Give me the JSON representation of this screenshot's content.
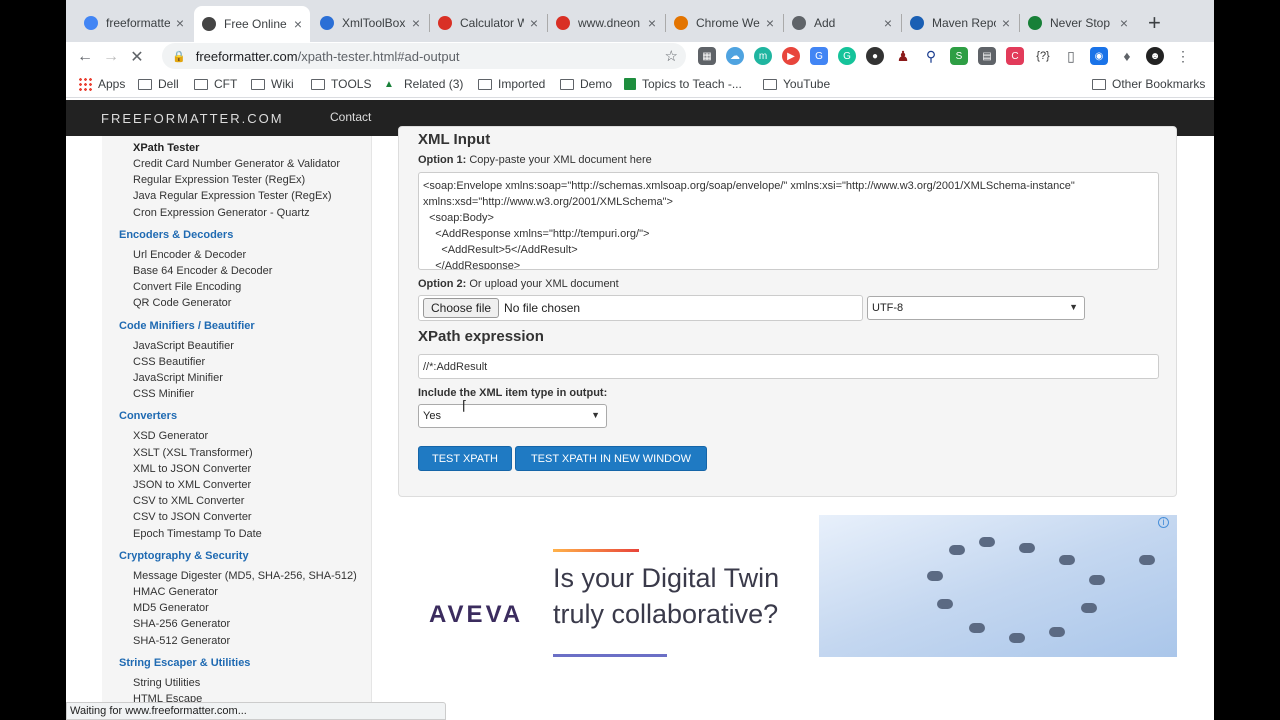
{
  "browser": {
    "tabs": [
      {
        "label": "freeformatte",
        "icon": "google-icon",
        "color": "#4285f4",
        "active": false
      },
      {
        "label": "Free Online",
        "icon": "freeformatter-icon",
        "color": "#444444",
        "active": true
      },
      {
        "label": "XmlToolBox",
        "icon": "xml-icon",
        "color": "#2b6fd6",
        "active": false
      },
      {
        "label": "Calculator W",
        "icon": "dneonline-icon",
        "color": "#d93025",
        "active": false
      },
      {
        "label": "www.dneon",
        "icon": "dneonline-icon",
        "color": "#d93025",
        "active": false
      },
      {
        "label": "Chrome We",
        "icon": "chrome-webstore-icon",
        "color": "#e37400",
        "active": false
      },
      {
        "label": "Add",
        "icon": "document-icon",
        "color": "#5f6368",
        "active": false
      },
      {
        "label": "Maven Repo",
        "icon": "maven-icon",
        "color": "#1a5fb4",
        "active": false
      },
      {
        "label": "Never Stop",
        "icon": "mountain-icon",
        "color": "#188038",
        "active": false
      }
    ],
    "new_tab": "+",
    "url_host": "freeformatter.com",
    "url_rest": "/xpath-tester.html#ad-output",
    "bookmarks": [
      "Apps",
      "Dell",
      "CFT",
      "Wiki",
      "TOOLS",
      "Related (3)",
      "Imported",
      "Demo",
      "Topics to Teach -...",
      "YouTube"
    ],
    "other_bookmarks": "Other Bookmarks",
    "status": "Waiting for www.freeformatter.com..."
  },
  "site": {
    "brand": "FREEFORMATTER.COM",
    "nav_contact": "Contact"
  },
  "sidebar": {
    "current": "XPath Tester",
    "groups": [
      {
        "items": [
          "Credit Card Number Generator & Validator",
          "Regular Expression Tester (RegEx)",
          "Java Regular Expression Tester (RegEx)",
          "Cron Expression Generator - Quartz"
        ]
      },
      {
        "heading": "Encoders & Decoders",
        "items": [
          "Url Encoder & Decoder",
          "Base 64 Encoder & Decoder",
          "Convert File Encoding",
          "QR Code Generator"
        ]
      },
      {
        "heading": "Code Minifiers / Beautifier",
        "items": [
          "JavaScript Beautifier",
          "CSS Beautifier",
          "JavaScript Minifier",
          "CSS Minifier"
        ]
      },
      {
        "heading": "Converters",
        "items": [
          "XSD Generator",
          "XSLT (XSL Transformer)",
          "XML to JSON Converter",
          "JSON to XML Converter",
          "CSV to XML Converter",
          "CSV to JSON Converter",
          "Epoch Timestamp To Date"
        ]
      },
      {
        "heading": "Cryptography & Security",
        "items": [
          "Message Digester (MD5, SHA-256, SHA-512)",
          "HMAC Generator",
          "MD5 Generator",
          "SHA-256 Generator",
          "SHA-512 Generator"
        ]
      },
      {
        "heading": "String Escaper & Utilities",
        "items": [
          "String Utilities",
          "HTML Escape"
        ]
      }
    ]
  },
  "form": {
    "heading_xml": "XML Input",
    "option1_bold": "Option 1:",
    "option1_text": " Copy-paste your XML document here",
    "xml_content": "<soap:Envelope xmlns:soap=\"http://schemas.xmlsoap.org/soap/envelope/\" xmlns:xsi=\"http://www.w3.org/2001/XMLSchema-instance\"\nxmlns:xsd=\"http://www.w3.org/2001/XMLSchema\">\n  <soap:Body>\n    <AddResponse xmlns=\"http://tempuri.org/\">\n      <AddResult>5</AddResult>\n    </AddResponse>",
    "option2_bold": "Option 2:",
    "option2_text": " Or upload your XML document",
    "choose_file": "Choose file",
    "no_file": "No file chosen",
    "encoding": "UTF-8",
    "heading_xpath": "XPath expression",
    "xpath_value": "//*:AddResult",
    "include_type_label": "Include the XML item type in output:",
    "include_type_value": "Yes",
    "btn_test": "TEST XPATH",
    "btn_test_new": "TEST XPATH IN NEW WINDOW"
  },
  "ad": {
    "logo": "AVEVA",
    "headline": "Is your Digital Twin\ntruly collaborative?",
    "info": "i"
  }
}
